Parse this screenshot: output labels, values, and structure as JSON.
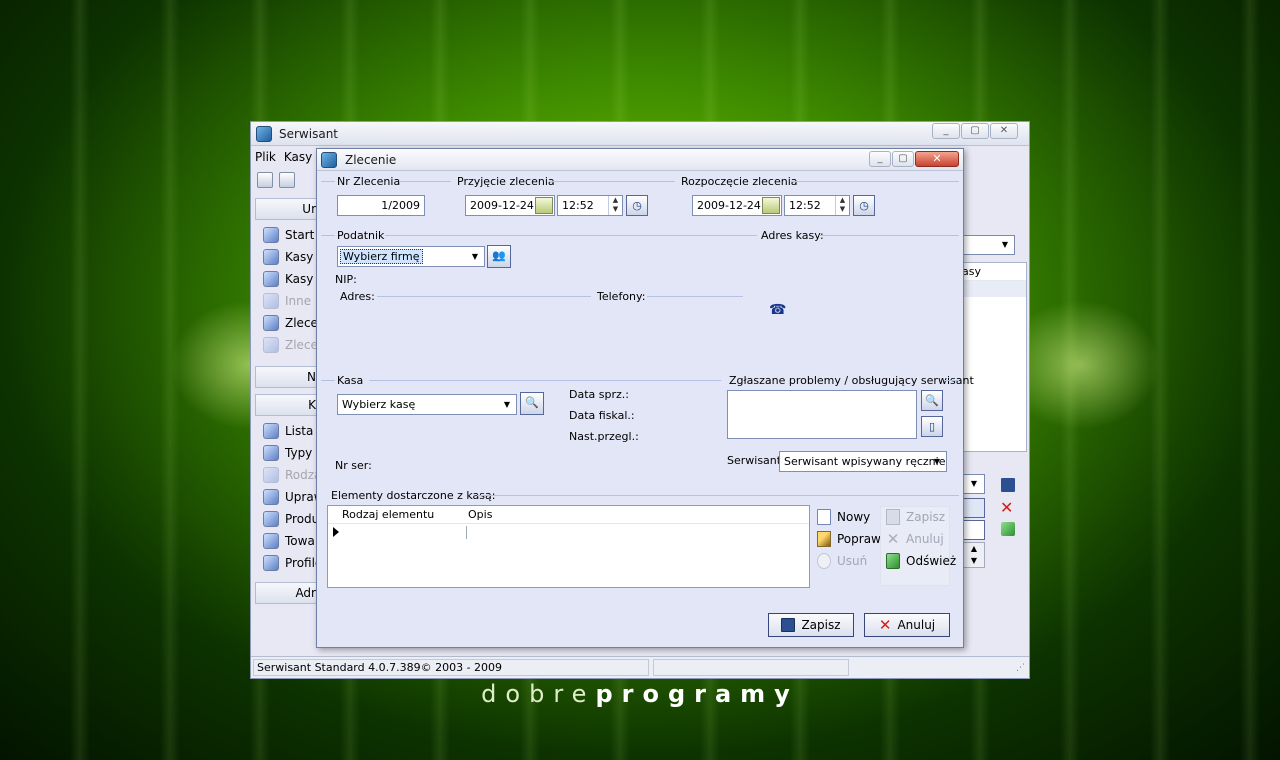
{
  "main_window": {
    "title": "Serwisant",
    "menu": [
      "Plik",
      "Kasy"
    ],
    "nav": {
      "group1_head": "Ur",
      "group1_items": [
        {
          "label": "Start",
          "enabled": true
        },
        {
          "label": "Kasy",
          "enabled": true
        },
        {
          "label": "Kasy u",
          "enabled": true
        },
        {
          "label": "Inne u",
          "enabled": false
        },
        {
          "label": "Zlece",
          "enabled": true
        },
        {
          "label": "Zlece",
          "enabled": false
        }
      ],
      "group2_head": "N",
      "group3_head": "K",
      "group3_items": [
        {
          "label": "Lista F",
          "enabled": true
        },
        {
          "label": "Typy k",
          "enabled": true
        },
        {
          "label": "Rodza",
          "enabled": false
        },
        {
          "label": "Upraw",
          "enabled": true
        },
        {
          "label": "Produ",
          "enabled": true
        },
        {
          "label": "Towa",
          "enabled": true
        },
        {
          "label": "Profile",
          "enabled": true
        }
      ],
      "group4_head": "Adr"
    },
    "right_combo_value": "I",
    "right_list_header": "asy",
    "status_text": "Serwisant Standard 4.0.7.389© 2003 - 2009"
  },
  "dialog": {
    "title": "Zlecenie",
    "nr_zlecenia": {
      "label": "Nr Zlecenia",
      "value": "1/2009"
    },
    "przyjecie": {
      "label": "Przyjęcie zlecenia",
      "date": "2009-12-24",
      "time": "12:52"
    },
    "rozpoczecie": {
      "label": "Rozpoczęcie zlecenia",
      "date": "2009-12-24",
      "time": "12:52"
    },
    "podatnik": {
      "label": "Podatnik",
      "value": "Wybierz firmę"
    },
    "adres_kasy_label": "Adres kasy:",
    "nip_label": "NIP:",
    "adres_label": "Adres:",
    "telefony_label": "Telefony:",
    "kasa": {
      "label": "Kasa",
      "value": "Wybierz kasę"
    },
    "data_sprz_label": "Data sprz.:",
    "data_fiskal_label": "Data fiskal.:",
    "nast_przegl_label": "Nast.przegl.:",
    "nr_ser_label": "Nr ser:",
    "problemy_label": "Zgłaszane problemy / obsługujący serwisant",
    "serwisant": {
      "label": "Serwisant:",
      "value": "Serwisant wpisywany ręcznie"
    },
    "elementy_label": "Elementy dostarczone z kasą:",
    "grid": {
      "columns": [
        "Rodzaj elementu",
        "Opis"
      ]
    },
    "grid_buttons": {
      "nowy": "Nowy",
      "popraw": "Popraw",
      "usun": "Usuń"
    },
    "panel_buttons": {
      "zapisz": "Zapisz",
      "anuluj": "Anuluj",
      "odswiez": "Odśwież"
    },
    "footer": {
      "zapisz": "Zapisz",
      "anuluj": "Anuluj"
    }
  },
  "branding": {
    "logo_light": "dobre",
    "logo_bold": "programy"
  }
}
